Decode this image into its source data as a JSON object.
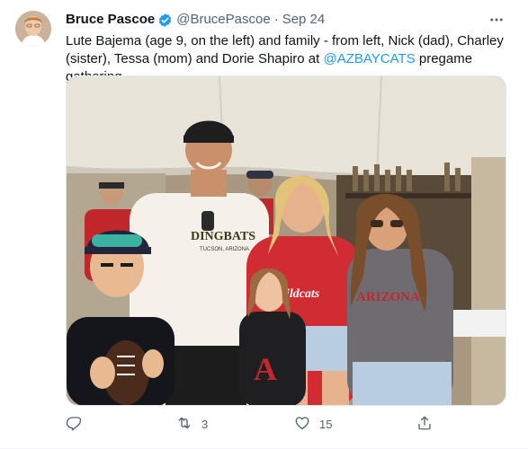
{
  "author": {
    "name": "Bruce Pascoe",
    "handle": "@BrucePascoe",
    "separator": "·",
    "date": "Sep 24"
  },
  "tweet": {
    "text_before": "Lute Bajema (age 9, on the left) and family - from left, Nick (dad), Charley (sister), Tessa (mom) and Dorie Shapiro at ",
    "mention": "@AZBAYCATS",
    "text_after": " pregame gathering"
  },
  "photo": {
    "shirt_text": "DINGBATS",
    "shirt_sub": "TUCSON, ARIZONA",
    "jersey_text": "Wildcats",
    "arizona_text": "ARIZONA",
    "logo_letter": "A"
  },
  "actions": {
    "reply_count": "",
    "retweet_count": "3",
    "like_count": "15"
  },
  "colors": {
    "accent": "#1d9bf0",
    "muted": "#536471"
  },
  "icons": [
    "verified-badge-icon",
    "more-icon",
    "reply-icon",
    "retweet-icon",
    "like-icon",
    "share-icon"
  ]
}
